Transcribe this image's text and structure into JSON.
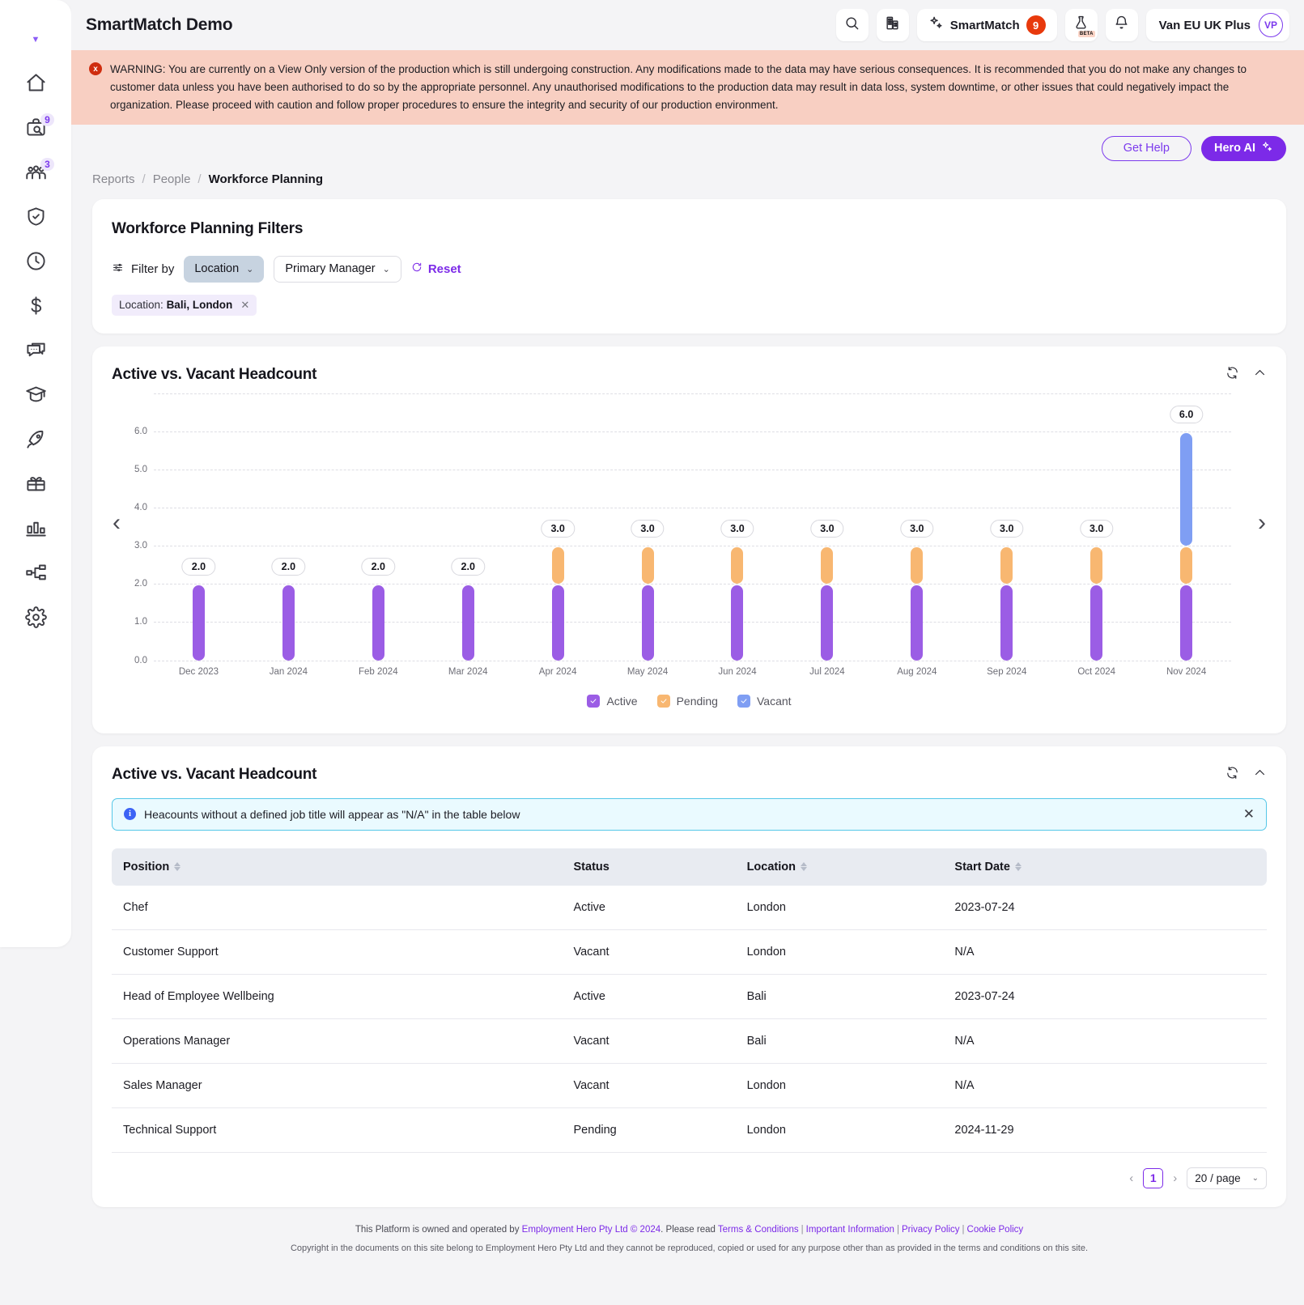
{
  "app": {
    "title": "SmartMatch Demo"
  },
  "topbar": {
    "search_icon": "search-icon",
    "building_icon": "building-icon",
    "smartmatch_label": "SmartMatch",
    "smartmatch_badge": "9",
    "beta_label": "BETA",
    "lab_icon": "flask-beta-icon",
    "bell_icon": "bell-icon",
    "user_name": "Van EU UK Plus",
    "user_initials": "VP"
  },
  "warning": {
    "icon": "x",
    "text": "WARNING: You are currently on a View Only version of the production which is still undergoing construction. Any modifications made to the data may have serious consequences. It is recommended that you do not make any changes to customer data unless you have been authorised to do so by the appropriate personnel. Any unauthorised modifications to the production data may result in data loss, system downtime, or other issues that could negatively impact the organization. Please proceed with caution and follow proper procedures to ensure the integrity and security of our production environment."
  },
  "sidebar": {
    "items": [
      {
        "name": "home",
        "badge": ""
      },
      {
        "name": "recruitment",
        "badge": "9"
      },
      {
        "name": "people",
        "badge": "3"
      },
      {
        "name": "compliance",
        "badge": ""
      },
      {
        "name": "time",
        "badge": ""
      },
      {
        "name": "payroll",
        "badge": ""
      },
      {
        "name": "feedback",
        "badge": ""
      },
      {
        "name": "learning",
        "badge": ""
      },
      {
        "name": "onboarding",
        "badge": ""
      },
      {
        "name": "benefits",
        "badge": ""
      },
      {
        "name": "reports",
        "badge": ""
      },
      {
        "name": "org-chart",
        "badge": ""
      },
      {
        "name": "settings",
        "badge": ""
      }
    ]
  },
  "actions": {
    "get_help": "Get Help",
    "hero_ai": "Hero AI"
  },
  "breadcrumb": {
    "reports": "Reports",
    "people": "People",
    "current": "Workforce Planning",
    "separator": "/"
  },
  "filters": {
    "title": "Workforce Planning Filters",
    "filter_by": "Filter by",
    "location_btn": "Location",
    "manager_btn": "Primary Manager",
    "reset": "Reset",
    "chip_label": "Location:",
    "chip_value": "Bali, London"
  },
  "chart_card": {
    "title": "Active vs. Vacant Headcount"
  },
  "table_card": {
    "title": "Active vs. Vacant Headcount",
    "info": "Heacounts without a defined job title will appear as \"N/A\" in the table below",
    "columns": [
      {
        "label": "Position",
        "sortable": true
      },
      {
        "label": "Status",
        "sortable": false
      },
      {
        "label": "Location",
        "sortable": true
      },
      {
        "label": "Start Date",
        "sortable": true
      }
    ],
    "rows": [
      {
        "position": "Chef",
        "status": "Active",
        "location": "London",
        "start_date": "2023-07-24"
      },
      {
        "position": "Customer Support",
        "status": "Vacant",
        "location": "London",
        "start_date": "N/A"
      },
      {
        "position": "Head of Employee Wellbeing",
        "status": "Active",
        "location": "Bali",
        "start_date": "2023-07-24"
      },
      {
        "position": "Operations Manager",
        "status": "Vacant",
        "location": "Bali",
        "start_date": "N/A"
      },
      {
        "position": "Sales Manager",
        "status": "Vacant",
        "location": "London",
        "start_date": "N/A"
      },
      {
        "position": "Technical Support",
        "status": "Pending",
        "location": "London",
        "start_date": "2024-11-29"
      }
    ],
    "pagination": {
      "prev": "‹",
      "next": "›",
      "page": "1",
      "page_size": "20 / page"
    }
  },
  "footer": {
    "line1_a": "This Platform is owned and operated by ",
    "owner": "Employment Hero Pty Ltd © 2024",
    "line1_b": ". Please read ",
    "terms": "Terms & Conditions",
    "important": "Important Information",
    "privacy": "Privacy Policy",
    "cookie": "Cookie Policy",
    "line2": "Copyright in the documents on this site belong to Employment Hero Pty Ltd and they cannot be reproduced, copied or used for any purpose other than as provided in the terms and conditions on this site."
  },
  "colors": {
    "active": "#9b5de5",
    "pending": "#f8b771",
    "vacant": "#7f9ef3",
    "brand": "#7c2ae8",
    "warning_bg": "#f8cfc2",
    "info_bg": "#eafaff"
  },
  "chart_data": {
    "type": "bar",
    "title": "Active vs. Vacant Headcount",
    "xlabel": "",
    "ylabel": "",
    "ylim": [
      0,
      7
    ],
    "yticks": [
      0.0,
      1.0,
      2.0,
      3.0,
      4.0,
      5.0,
      6.0
    ],
    "ytick_labels": [
      "0.0",
      "1.0",
      "2.0",
      "3.0",
      "4.0",
      "5.0",
      "6.0"
    ],
    "grid": true,
    "stacked": true,
    "legend_position": "bottom",
    "categories": [
      "Dec 2023",
      "Jan 2024",
      "Feb 2024",
      "Mar 2024",
      "Apr 2024",
      "May 2024",
      "Jun 2024",
      "Jul 2024",
      "Aug 2024",
      "Sep 2024",
      "Oct 2024",
      "Nov 2024"
    ],
    "series": [
      {
        "name": "Active",
        "color": "#9b5de5",
        "values": [
          2,
          2,
          2,
          2,
          2,
          2,
          2,
          2,
          2,
          2,
          2,
          2
        ]
      },
      {
        "name": "Pending",
        "color": "#f8b771",
        "values": [
          0,
          0,
          0,
          0,
          1,
          1,
          1,
          1,
          1,
          1,
          1,
          1
        ]
      },
      {
        "name": "Vacant",
        "color": "#7f9ef3",
        "values": [
          0,
          0,
          0,
          0,
          0,
          0,
          0,
          0,
          0,
          0,
          0,
          3
        ]
      }
    ],
    "totals": [
      2.0,
      2.0,
      2.0,
      2.0,
      3.0,
      3.0,
      3.0,
      3.0,
      3.0,
      3.0,
      3.0,
      6.0
    ],
    "total_labels": [
      "2.0",
      "2.0",
      "2.0",
      "2.0",
      "3.0",
      "3.0",
      "3.0",
      "3.0",
      "3.0",
      "3.0",
      "3.0",
      "6.0"
    ],
    "legend": [
      {
        "label": "Active",
        "color": "#9b5de5",
        "checked": true
      },
      {
        "label": "Pending",
        "color": "#f8b771",
        "checked": true
      },
      {
        "label": "Vacant",
        "color": "#7f9ef3",
        "checked": true
      }
    ]
  }
}
